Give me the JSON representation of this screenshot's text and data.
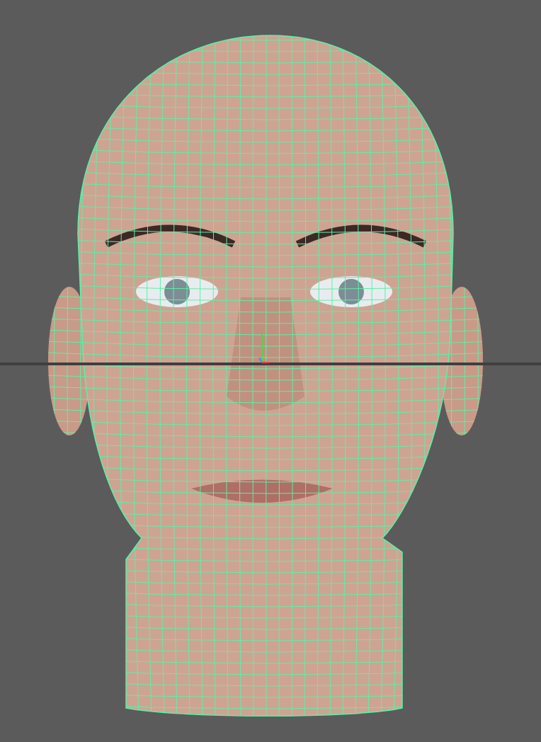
{
  "viewport": {
    "wireframe_on_shaded": true,
    "grid": true
  }
}
